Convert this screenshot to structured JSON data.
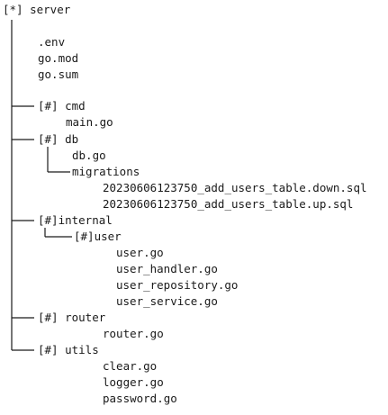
{
  "tree": {
    "nodes": [
      {
        "id": "server",
        "label": "[*] server"
      },
      {
        "id": "env",
        "label": ".env"
      },
      {
        "id": "gomod",
        "label": "go.mod"
      },
      {
        "id": "gosum",
        "label": "go.sum"
      },
      {
        "id": "cmd",
        "label": "[#] cmd"
      },
      {
        "id": "maingo",
        "label": "main.go"
      },
      {
        "id": "db",
        "label": "[#] db"
      },
      {
        "id": "dbgo",
        "label": "db.go"
      },
      {
        "id": "migrations",
        "label": "migrations"
      },
      {
        "id": "mig-down",
        "label": "20230606123750_add_users_table.down.sql"
      },
      {
        "id": "mig-up",
        "label": "20230606123750_add_users_table.up.sql"
      },
      {
        "id": "internal",
        "label": "[#]internal"
      },
      {
        "id": "user",
        "label": "[#]user"
      },
      {
        "id": "usergo",
        "label": "user.go"
      },
      {
        "id": "user-handler",
        "label": "user_handler.go"
      },
      {
        "id": "user-repository",
        "label": "user_repository.go"
      },
      {
        "id": "user-service",
        "label": "user_service.go"
      },
      {
        "id": "router",
        "label": "[#] router"
      },
      {
        "id": "routergo",
        "label": "router.go"
      },
      {
        "id": "utils",
        "label": "[#] utils"
      },
      {
        "id": "cleargo",
        "label": "clear.go"
      },
      {
        "id": "loggergo",
        "label": "logger.go"
      },
      {
        "id": "passwordgo",
        "label": "password.go"
      }
    ]
  },
  "colors": {
    "text": "#1a1a1a",
    "line": "#1a1a1a",
    "background": "#ffffff"
  }
}
